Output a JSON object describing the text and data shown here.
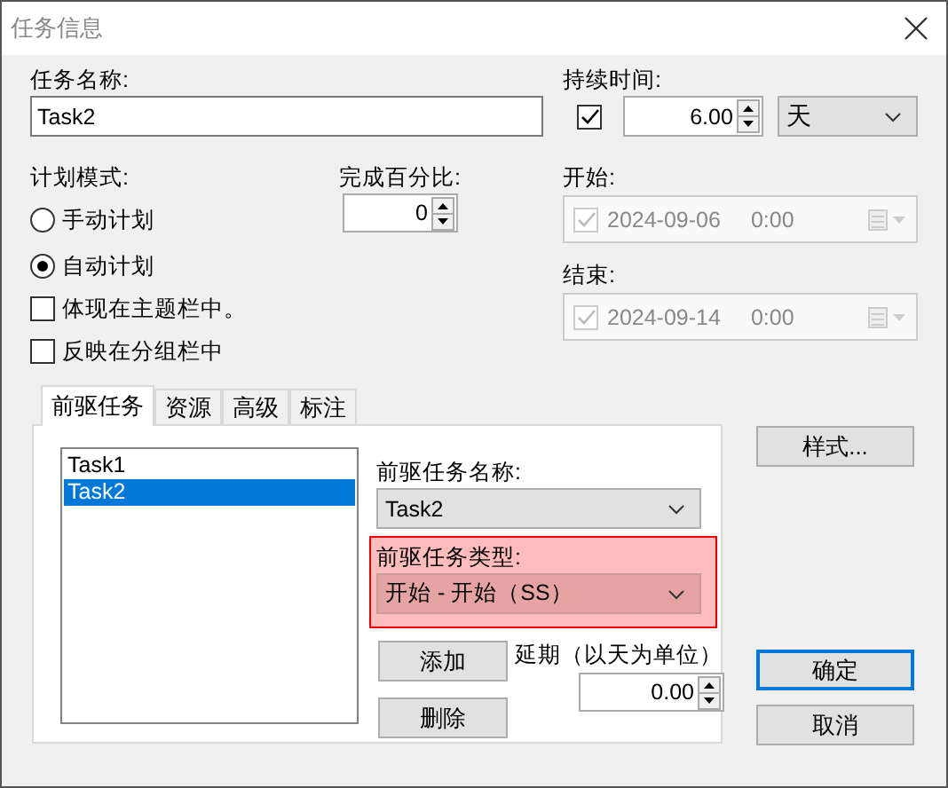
{
  "window": {
    "title": "任务信息"
  },
  "task_name": {
    "label": "任务名称:",
    "value": "Task2"
  },
  "duration": {
    "label": "持续时间:",
    "checked": true,
    "value": "6.00",
    "unit": "天"
  },
  "schedule_mode": {
    "label": "计划模式:",
    "options": [
      {
        "label": "手动计划",
        "selected": false
      },
      {
        "label": "自动计划",
        "selected": true
      }
    ]
  },
  "percent_complete": {
    "label": "完成百分比:",
    "value": "0"
  },
  "start": {
    "label": "开始:",
    "checked": true,
    "disabled": true,
    "date": "2024-09-06",
    "time": "0:00"
  },
  "finish": {
    "label": "结束:",
    "checked": true,
    "disabled": true,
    "date": "2024-09-14",
    "time": "0:00"
  },
  "checkboxes": [
    {
      "label": "体现在主题栏中。",
      "checked": false
    },
    {
      "label": "反映在分组栏中",
      "checked": false
    }
  ],
  "tabs": [
    {
      "label": "前驱任务",
      "selected": true
    },
    {
      "label": "资源",
      "selected": false
    },
    {
      "label": "高级",
      "selected": false
    },
    {
      "label": "标注",
      "selected": false
    }
  ],
  "predecessors": {
    "list": [
      {
        "label": "Task1",
        "selected": false
      },
      {
        "label": "Task2",
        "selected": true
      }
    ],
    "name_label": "前驱任务名称:",
    "name_value": "Task2",
    "type_label": "前驱任务类型:",
    "type_value": "开始 - 开始（SS）",
    "type_highlighted": true,
    "add": "添加",
    "delete": "删除",
    "lag_label": "延期（以天为单位）",
    "lag_value": "0.00"
  },
  "buttons": [
    {
      "label": "样式...",
      "default": false
    },
    {
      "label": "确定",
      "default": true
    },
    {
      "label": "取消",
      "default": false
    }
  ]
}
